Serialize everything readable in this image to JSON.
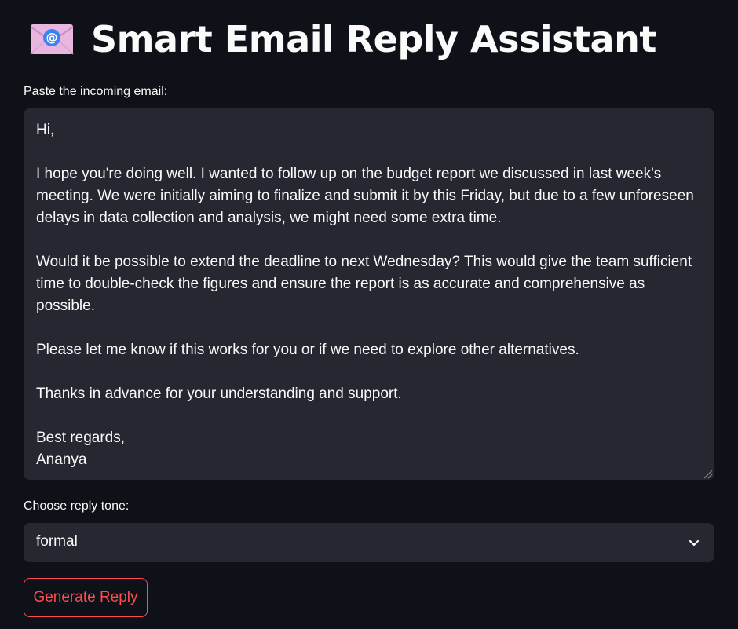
{
  "header": {
    "title": "Smart Email Reply Assistant",
    "icon": "email-icon"
  },
  "email_input": {
    "label": "Paste the incoming email:",
    "value": "Hi,\n\nI hope you're doing well. I wanted to follow up on the budget report we discussed in last week's meeting. We were initially aiming to finalize and submit it by this Friday, but due to a few unforeseen delays in data collection and analysis, we might need some extra time.\n\nWould it be possible to extend the deadline to next Wednesday? This would give the team sufficient time to double-check the figures and ensure the report is as accurate and comprehensive as possible.\n\nPlease let me know if this works for you or if we need to explore other alternatives.\n\nThanks in advance for your understanding and support.\n\nBest regards,\nAnanya"
  },
  "tone_select": {
    "label": "Choose reply tone:",
    "selected": "formal"
  },
  "actions": {
    "generate_label": "Generate Reply"
  },
  "colors": {
    "background": "#0e1117",
    "input_background": "#262730",
    "accent": "#ff4b4b",
    "text": "#fafafa"
  }
}
